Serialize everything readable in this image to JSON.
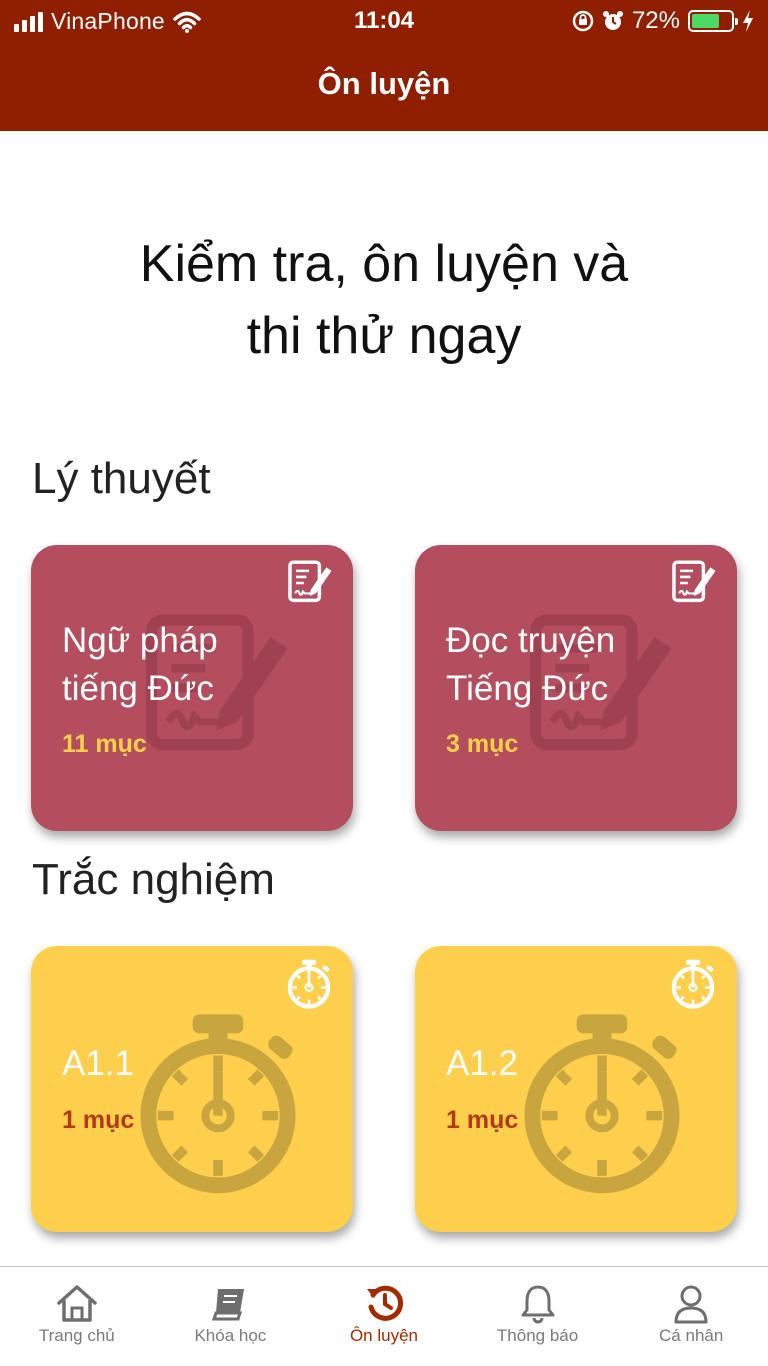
{
  "status_bar": {
    "carrier": "VinaPhone",
    "time": "11:04",
    "battery_percent": "72%",
    "battery_level": 0.72,
    "icons": [
      "signal-icon",
      "wifi-icon",
      "rotation-lock-icon",
      "alarm-icon",
      "battery-icon",
      "charging-icon"
    ]
  },
  "header": {
    "title": "Ôn luyện",
    "background": "#8f1f00"
  },
  "hero": {
    "line1": "Kiểm tra, ôn luyện và",
    "line2": "thi thử ngay"
  },
  "sections": {
    "theory": {
      "title": "Lý thuyết",
      "color": "#b44e5e",
      "icon": "document-edit-icon",
      "cards": [
        {
          "title_line1": "Ngữ pháp",
          "title_line2": "tiếng Đức",
          "count": "11 mục"
        },
        {
          "title_line1": "Đọc truyện",
          "title_line2": "Tiếng Đức",
          "count": "3 mục"
        }
      ]
    },
    "quiz": {
      "title": "Trắc nghiệm",
      "color": "#fdcf4c",
      "icon": "stopwatch-icon",
      "cards": [
        {
          "title": "A1.1",
          "count": "1 mục"
        },
        {
          "title": "A1.2",
          "count": "1 mục"
        }
      ]
    }
  },
  "bottom_nav": {
    "active_color": "#a52a00",
    "items": [
      {
        "label": "Trang chủ",
        "icon": "home-icon"
      },
      {
        "label": "Khóa học",
        "icon": "book-icon"
      },
      {
        "label": "Ôn luyện",
        "icon": "history-icon",
        "active": true
      },
      {
        "label": "Thông báo",
        "icon": "bell-icon"
      },
      {
        "label": "Cá nhân",
        "icon": "user-icon"
      }
    ]
  }
}
